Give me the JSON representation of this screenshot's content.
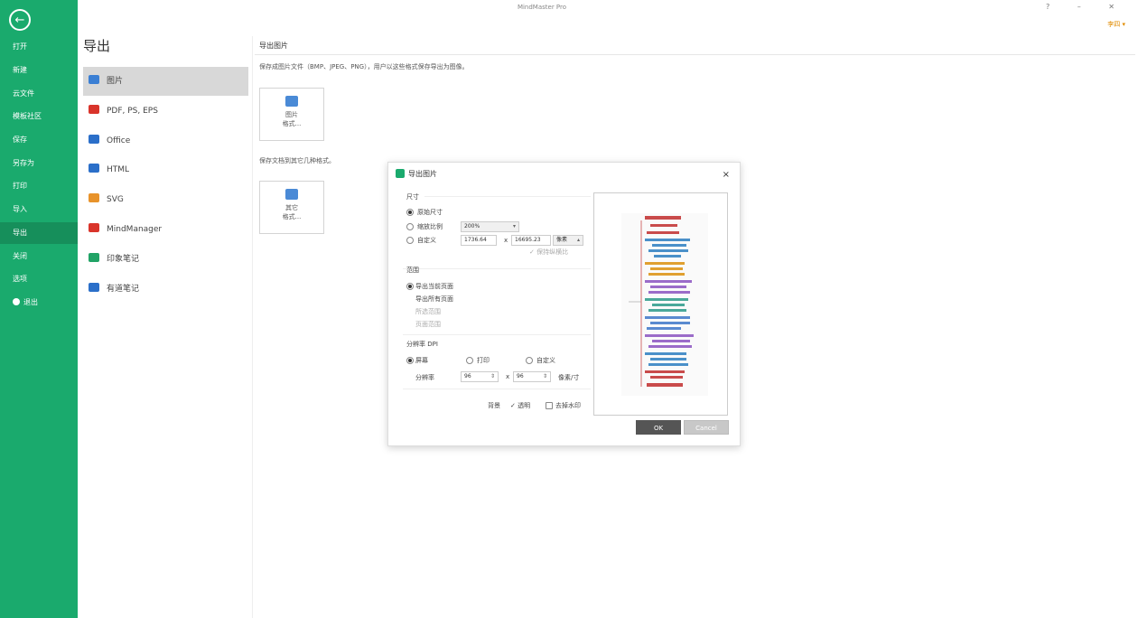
{
  "app": {
    "title": "MindMaster Pro",
    "window_controls": "? – ✕",
    "user_badge": "李四 ▾"
  },
  "sidebar": {
    "back_icon": "arrow-left-icon",
    "items": [
      {
        "label": "打开"
      },
      {
        "label": "新建"
      },
      {
        "label": "云文件"
      },
      {
        "label": "模板社区"
      },
      {
        "label": "保存"
      },
      {
        "label": "另存为"
      },
      {
        "label": "打印"
      },
      {
        "label": "导入"
      },
      {
        "label": "导出"
      },
      {
        "label": "关闭"
      },
      {
        "label": "选项"
      },
      {
        "label": "退出"
      }
    ],
    "active_index": 8
  },
  "export_panel": {
    "title": "导出",
    "formats": [
      {
        "label": "图片",
        "color": "#3b7fd4"
      },
      {
        "label": "PDF, PS, EPS",
        "color": "#d9342b"
      },
      {
        "label": "Office",
        "color": "#2b6fc9"
      },
      {
        "label": "HTML",
        "color": "#2b6fc9"
      },
      {
        "label": "SVG",
        "color": "#e8932b"
      },
      {
        "label": "MindManager",
        "color": "#d9342b"
      },
      {
        "label": "印象笔记",
        "color": "#21a366"
      },
      {
        "label": "有道笔记",
        "color": "#2b6fc9"
      }
    ]
  },
  "content": {
    "section_title": "导出图片",
    "desc1": "保存成图片文件（BMP、JPEG、PNG），用户以这些格式保存导出为图像。",
    "card1": {
      "line1": "图片",
      "line2": "格式..."
    },
    "desc2": "保存文档到其它几种格式。",
    "card2": {
      "line1": "其它",
      "line2": "格式..."
    }
  },
  "dialog": {
    "title": "导出图片",
    "close": "×",
    "size_section": "尺寸",
    "size_original": "原始尺寸",
    "zoom_label": "缩放比例",
    "zoom_value": "200%",
    "custom_label": "自定义",
    "width_value": "1736.64",
    "x_sign": "x",
    "height_value": "16695.23",
    "unit_value": "像素",
    "keep_ratio": "保持纵横比",
    "range_section": "范围",
    "range_current": "导出当前页面",
    "range_all": "导出所有页面",
    "range_selected": "所选范围",
    "range_pages": "页面范围",
    "resolution_section": "分辨率 DPI",
    "res_screen": "屏幕",
    "res_print": "打印",
    "res_custom": "自定义",
    "res_label": "分辨率",
    "res_h": "96",
    "res_times": "x",
    "res_v": "96",
    "res_unit": "像素/寸",
    "bg_label": "背景",
    "trans_label": "透明",
    "watermark_label": "去掉水印",
    "ok": "OK",
    "cancel": "Cancel"
  }
}
